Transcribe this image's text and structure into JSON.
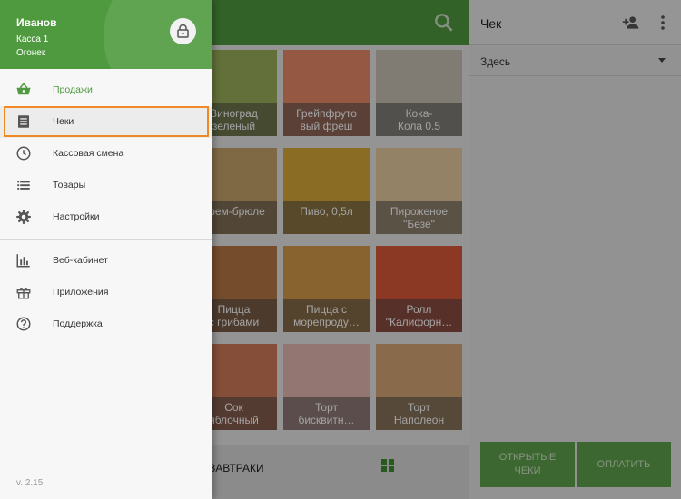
{
  "header": {
    "search_icon": "search-icon"
  },
  "products": [
    {
      "name": "Виноград\nзеленый",
      "color": "#9bb05a"
    },
    {
      "name": "Грейпфруто\nвый фреш",
      "color": "#e88a6a"
    },
    {
      "name": "Кока-\nКола 0.5",
      "color": "#c23a34"
    },
    {
      "name": "Крем-брюле",
      "color": "#c7a56b"
    },
    {
      "name": "Пиво, 0,5л",
      "color": "#d9a93a"
    },
    {
      "name": "Пироженое\n\"Безе\"",
      "color": "#e8cba0"
    },
    {
      "name": "Пицца\nс грибами",
      "color": "#b77745"
    },
    {
      "name": "Пицца с\nморепроду…",
      "color": "#d59a4a"
    },
    {
      "name": "Ролл\n\"Калифорн…",
      "color": "#d9583a"
    },
    {
      "name": "Сок\nяблочный",
      "color": "#d07a5a"
    },
    {
      "name": "Торт\nбисквитн…",
      "color": "#e6b9b2"
    },
    {
      "name": "Торт\nНаполеон",
      "color": "#d7a878"
    }
  ],
  "category": {
    "label": "ЗАВТРАКИ"
  },
  "check_panel": {
    "title": "Чек",
    "place": "Здесь",
    "open_checks": "ОТКРЫТЫЕ\nЧЕКИ",
    "pay": "ОПЛАТИТЬ"
  },
  "drawer": {
    "user_name": "Иванов",
    "kassa": "Касса 1",
    "shop": "Огонек",
    "items": [
      {
        "label": "Продажи",
        "icon": "basket-icon"
      },
      {
        "label": "Чеки",
        "icon": "receipt-icon"
      },
      {
        "label": "Кассовая смена",
        "icon": "clock-icon"
      },
      {
        "label": "Товары",
        "icon": "list-icon"
      },
      {
        "label": "Настройки",
        "icon": "gear-icon"
      },
      {
        "label": "Веб-кабинет",
        "icon": "chart-icon"
      },
      {
        "label": "Приложения",
        "icon": "gift-icon"
      },
      {
        "label": "Поддержка",
        "icon": "help-icon"
      }
    ],
    "version": "v. 2.15"
  },
  "colors": {
    "accent": "#4f9a3f",
    "highlight": "#f08a24"
  }
}
